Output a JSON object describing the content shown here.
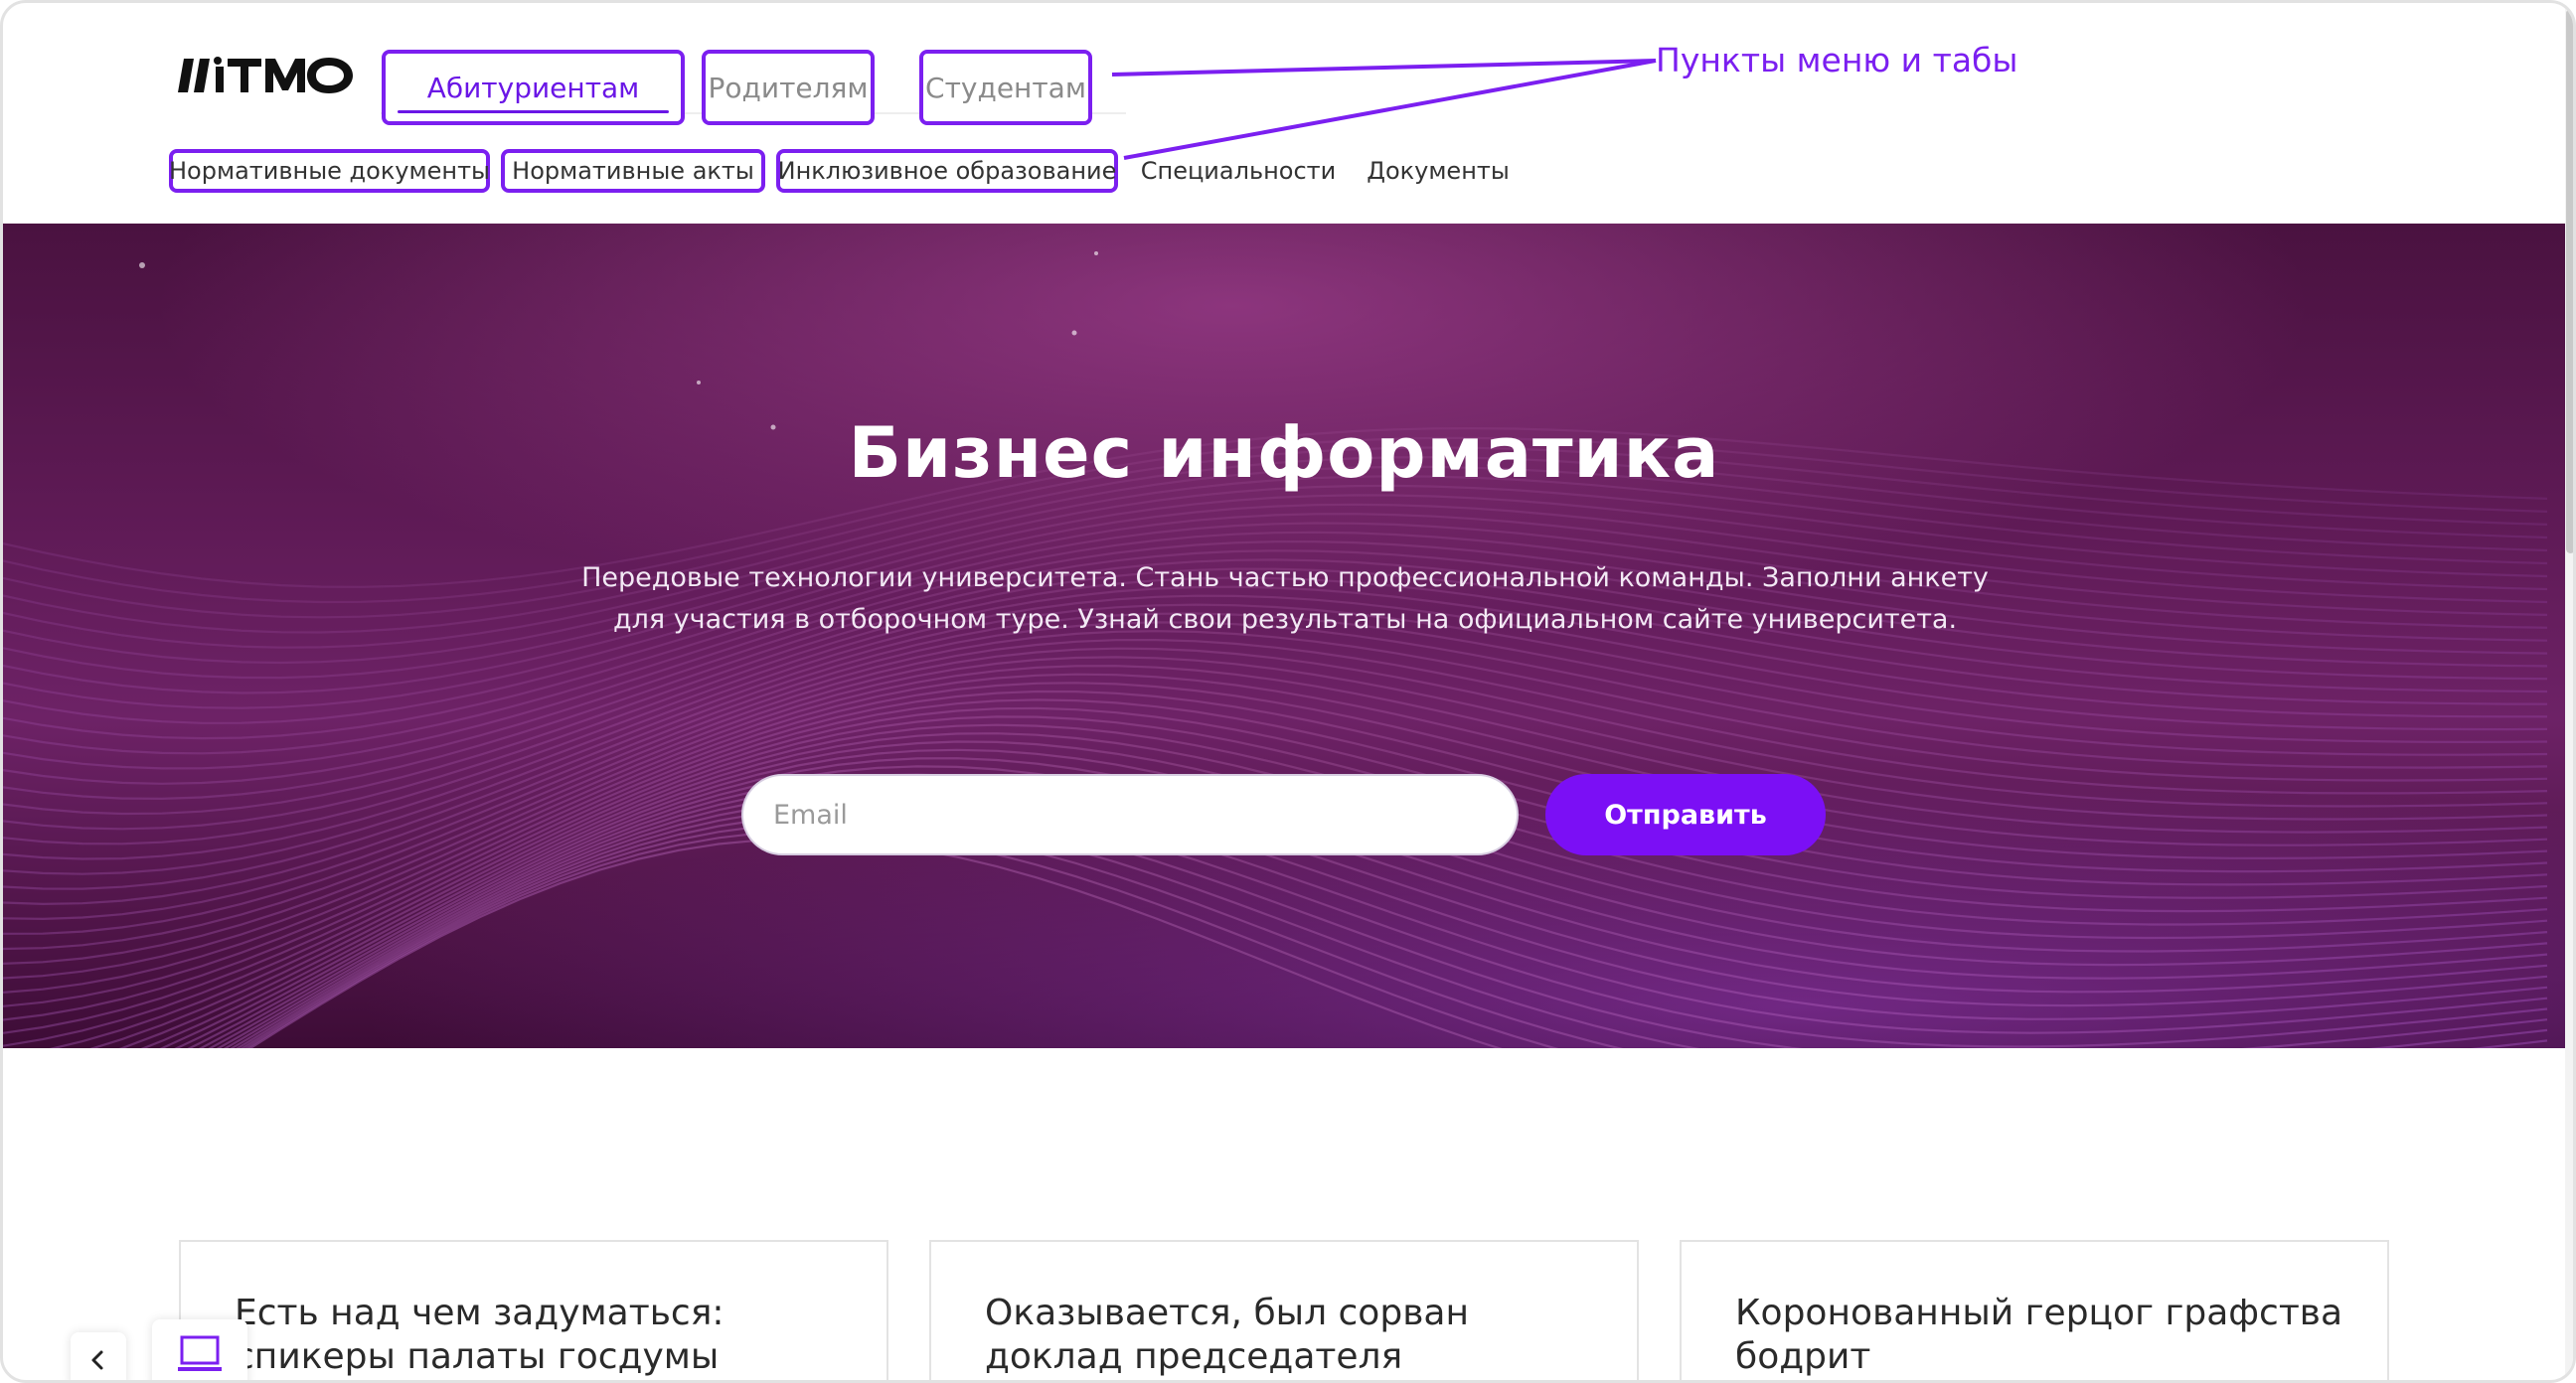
{
  "header": {
    "logo_text": "ITMO",
    "tabs": [
      {
        "label": "Абитуриентам",
        "active": true
      },
      {
        "label": "Родителям",
        "active": false
      },
      {
        "label": "Студентам",
        "active": false
      }
    ],
    "subnav": [
      {
        "label": "Нормативные документы"
      },
      {
        "label": "Нормативные акты"
      },
      {
        "label": "Инклюзивное образование"
      },
      {
        "label": "Специальности"
      },
      {
        "label": "Документы"
      }
    ]
  },
  "annotation": {
    "label": "Пункты меню и табы",
    "color": "#7b1ff0"
  },
  "hero": {
    "title": "Бизнес информатика",
    "subtitle": "Передовые технологии университета. Стань частью профессиональной команды. Заполни анкету для участия в отборочном туре. Узнай свои результаты на официальном сайте университета.",
    "email_placeholder": "Email",
    "email_value": "",
    "submit_label": "Отправить",
    "accent_color": "#7b0ff5"
  },
  "cards": [
    {
      "title": "Есть над чем задуматься: спикеры палаты госдумы"
    },
    {
      "title": "Оказывается, был сорван доклад председателя"
    },
    {
      "title": "Коронованный герцог графства бодрит"
    }
  ],
  "controls": {
    "back_icon": "chevron-left-icon",
    "device_icon": "laptop-icon"
  }
}
